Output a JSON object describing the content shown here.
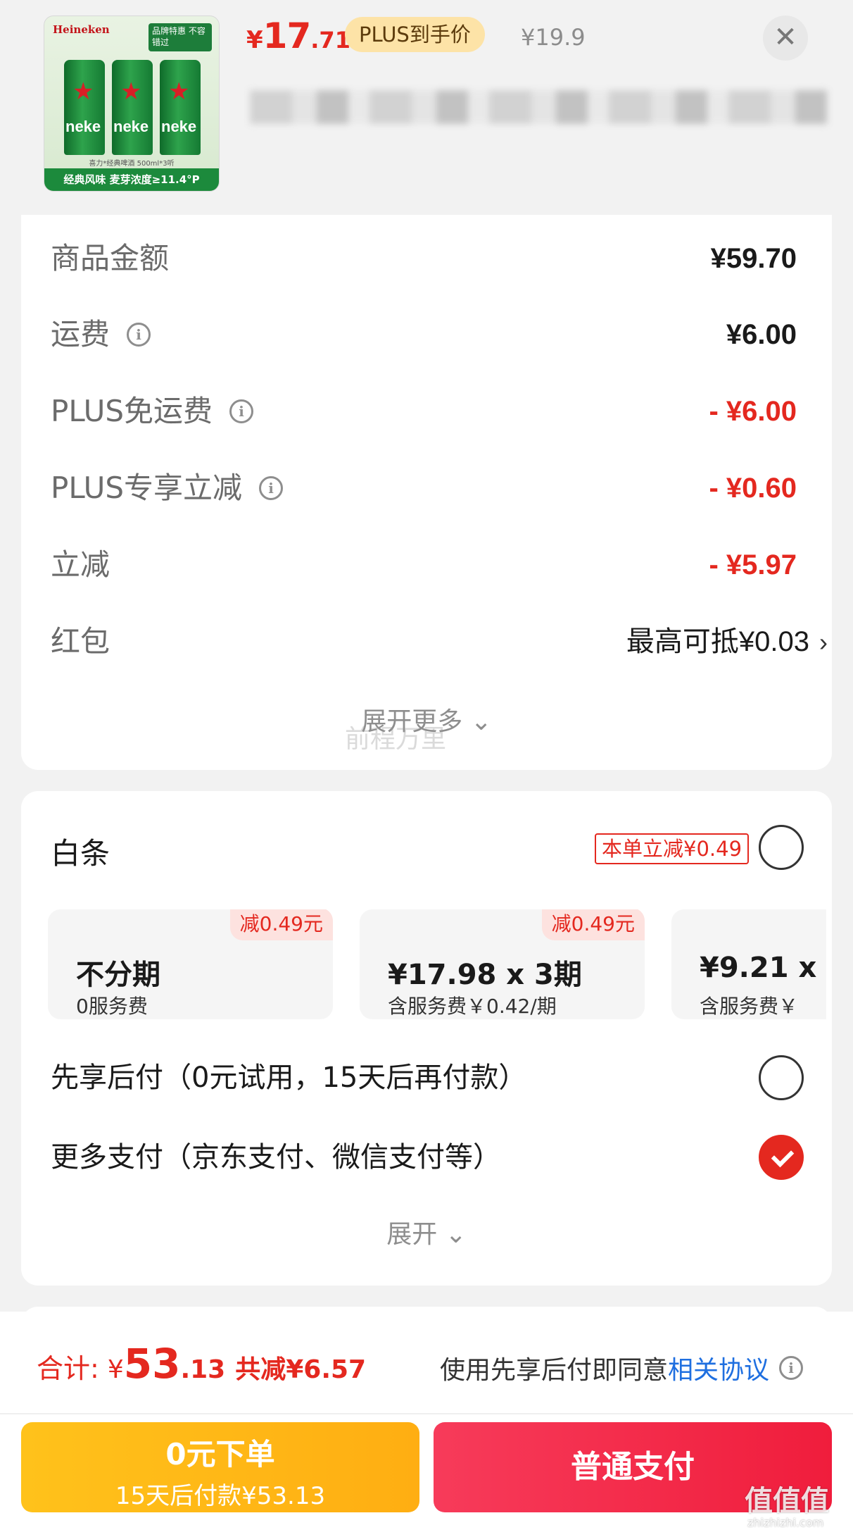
{
  "product": {
    "price_currency": "¥",
    "price_int": "17",
    "price_dec": ".71",
    "plus_pill": "PLUS到手价",
    "original_price": "¥19.9",
    "close_icon": "close-icon",
    "image": {
      "brand": "Heineken",
      "tag": "品牌特惠 不容错过",
      "can_text": "neke",
      "note": "喜力*经典啤酒 500ml*3听",
      "bottom_bar": "经典风味  麦芽浓度≥11.4°P"
    }
  },
  "fees": [
    {
      "label": "商品金额",
      "value": "¥59.70",
      "info": false,
      "style": "normal"
    },
    {
      "label": "运费",
      "value": "¥6.00",
      "info": true,
      "style": "normal"
    },
    {
      "label": "PLUS免运费",
      "value": "- ¥6.00",
      "info": true,
      "style": "red"
    },
    {
      "label": "PLUS专享立减",
      "value": "- ¥0.60",
      "info": true,
      "style": "red"
    },
    {
      "label": "立减",
      "value": "- ¥5.97",
      "info": false,
      "style": "red"
    },
    {
      "label": "红包",
      "value": "最高可抵¥0.03",
      "info": false,
      "style": "redpack"
    }
  ],
  "expand_more": "展开更多 ⌄",
  "watermark": "前程万里",
  "baitiao": {
    "title": "白条",
    "badge": "本单立减¥0.49",
    "plans": [
      {
        "tag": "减0.49元",
        "main": "不分期",
        "sub": "0服务费"
      },
      {
        "tag": "减0.49元",
        "main": "¥17.98 x 3期",
        "sub": "含服务费￥0.42/期"
      },
      {
        "tag": "",
        "main": "¥9.21 x",
        "sub": "含服务费￥"
      }
    ]
  },
  "pay_options": [
    {
      "label": "先享后付（0元试用，15天后再付款）",
      "checked": false
    },
    {
      "label": "更多支付（京东支付、微信支付等）",
      "checked": true
    }
  ],
  "expand": "展开 ⌄",
  "bottom": {
    "total_label": "合计:",
    "total_cur": "¥",
    "total_int": "53",
    "total_dec": ".13",
    "total_saved": "共减¥6.57",
    "agree_text": "使用先享后付即同意",
    "agree_link": "相关协议",
    "zero_btn_l1": "0元下单",
    "zero_btn_l2": "15天后付款¥53.13",
    "pay_btn": "普通支付"
  },
  "site_mark": "值值值",
  "site_url": "zhizhizhi.com",
  "colors": {
    "accent_red": "#e4281f",
    "link_blue": "#1f6fe0",
    "pill_gold": "#fde3a7"
  }
}
